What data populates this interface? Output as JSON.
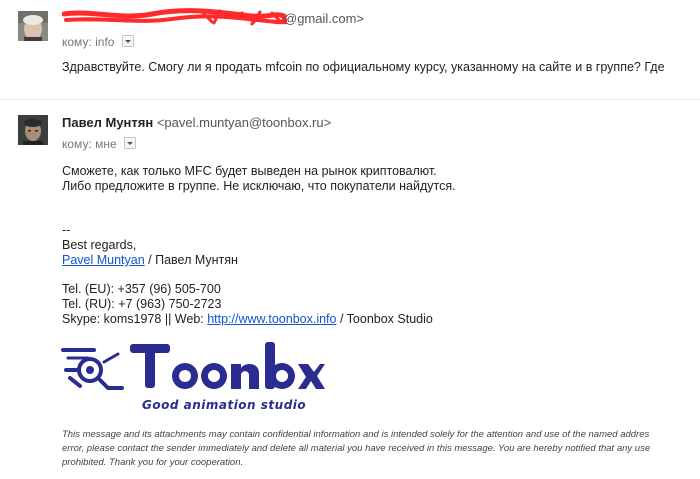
{
  "message1": {
    "sender_email_visible": "@gmail.com>",
    "to_label": "кому: info",
    "body": "Здравствуйте. Смогу ли я продать mfcoin по официальному курсу, указанному на сайте и в группе? Где"
  },
  "message2": {
    "sender_name": "Павел Мунтян",
    "sender_email": "<pavel.muntyan@toonbox.ru>",
    "to_label": "кому: мне",
    "body_lines": [
      "Сможете, как только MFC будет выведен на рынок криптовалют.",
      "Либо предложите в группе. Не исключаю, что покупатели найдутся."
    ],
    "signature": {
      "dashes": "--",
      "regards": "Best regards,",
      "name_link": "Pavel Muntyan",
      "name_suffix": " / Павел Мунтян",
      "tel_eu": "Tel. (EU): +357 (96) 505-700",
      "tel_ru": "Tel. (RU): +7 (963) 750-2723",
      "skype_prefix": "Skype: koms1978 || Web: ",
      "web_link": "http://www.toonbox.info",
      "web_suffix": " / Toonbox Studio"
    },
    "logo": {
      "brand": "Toonbox",
      "tagline": "Good animation studio",
      "color": "#2b2c8f"
    },
    "disclaimer_lines": [
      "This message and its attachments may contain confidential information and is intended solely for the attention and use of the named addres",
      "error, please contact the sender immediately and delete all material you have received in this message. You are hereby notified that any use",
      "prohibited. Thank you for your cooperation."
    ]
  },
  "colors": {
    "link": "#1155cc",
    "redaction": "#ff2a2a",
    "logo_blue": "#2b2c8f"
  }
}
